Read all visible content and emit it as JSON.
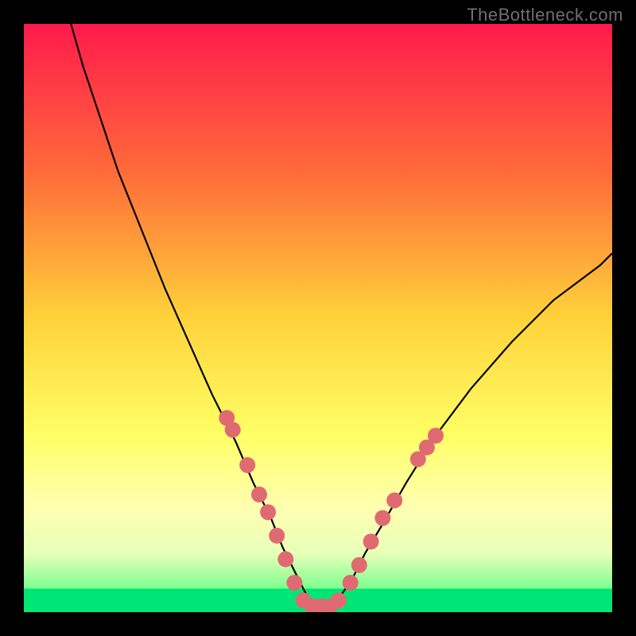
{
  "watermark": "TheBottleneck.com",
  "chart_data": {
    "type": "line",
    "title": "",
    "xlabel": "",
    "ylabel": "",
    "xlim": [
      0,
      100
    ],
    "ylim": [
      0,
      100
    ],
    "background_gradient": {
      "stops": [
        {
          "offset": 0,
          "color": "#ff1a4b"
        },
        {
          "offset": 25,
          "color": "#ff6a3a"
        },
        {
          "offset": 50,
          "color": "#ffd23a"
        },
        {
          "offset": 70,
          "color": "#ffff66"
        },
        {
          "offset": 82,
          "color": "#ffffb0"
        },
        {
          "offset": 90,
          "color": "#e8ffb8"
        },
        {
          "offset": 96,
          "color": "#7dff8f"
        },
        {
          "offset": 100,
          "color": "#00e676"
        }
      ]
    },
    "series": [
      {
        "name": "bottleneck-curve",
        "color": "#000000",
        "width": 2.2,
        "x": [
          8,
          10,
          13,
          16,
          20,
          24,
          28,
          32,
          36,
          39,
          42,
          44,
          46,
          48,
          50,
          52,
          54,
          56,
          58,
          61,
          65,
          70,
          76,
          83,
          90,
          98,
          100
        ],
        "y": [
          100,
          93,
          84,
          75,
          65,
          55,
          46,
          37,
          29,
          22,
          16,
          11,
          7,
          3,
          1,
          1,
          3,
          6,
          10,
          15,
          22,
          30,
          38,
          46,
          53,
          59,
          61
        ]
      }
    ],
    "markers": {
      "name": "highlight-dots",
      "color": "#e06a72",
      "radius": 10,
      "points": [
        {
          "x": 34.5,
          "y": 33
        },
        {
          "x": 35.5,
          "y": 31
        },
        {
          "x": 38.0,
          "y": 25
        },
        {
          "x": 40.0,
          "y": 20
        },
        {
          "x": 41.5,
          "y": 17
        },
        {
          "x": 43.0,
          "y": 13
        },
        {
          "x": 44.5,
          "y": 9
        },
        {
          "x": 46.0,
          "y": 5
        },
        {
          "x": 47.5,
          "y": 2
        },
        {
          "x": 49.0,
          "y": 1
        },
        {
          "x": 50.5,
          "y": 1
        },
        {
          "x": 52.0,
          "y": 1
        },
        {
          "x": 53.5,
          "y": 2
        },
        {
          "x": 55.5,
          "y": 5
        },
        {
          "x": 57.0,
          "y": 8
        },
        {
          "x": 59.0,
          "y": 12
        },
        {
          "x": 61.0,
          "y": 16
        },
        {
          "x": 63.0,
          "y": 19
        },
        {
          "x": 67.0,
          "y": 26
        },
        {
          "x": 68.5,
          "y": 28
        },
        {
          "x": 70.0,
          "y": 30
        }
      ]
    },
    "green_band": {
      "y_from": 0,
      "y_to": 4
    }
  }
}
